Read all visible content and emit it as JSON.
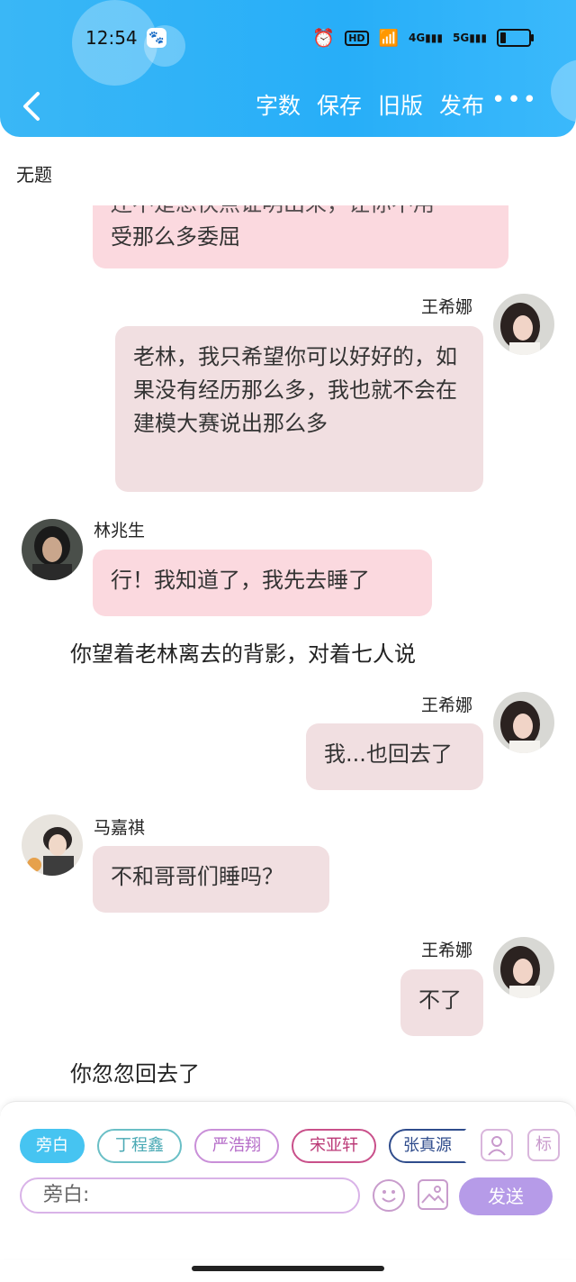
{
  "status": {
    "time": "12:54",
    "app_icon": "baidu-paw-icon",
    "hd_label": "HD",
    "signal_4g": "4G",
    "signal_5g": "5G"
  },
  "header": {
    "back_icon": "chevron-left-icon",
    "actions": [
      "字数",
      "保存",
      "旧版",
      "发布"
    ],
    "more_label": "•••"
  },
  "doc": {
    "title": "无题"
  },
  "messages": [
    {
      "type": "bubble-cut",
      "text": "受那么多委屈",
      "partial_text": "还不是想快点证明出来，让你不用"
    },
    {
      "type": "right",
      "name": "王希娜",
      "text": "老林，我只希望你可以好好的，如果没有经历那么多，我也就不会在建模大赛说出那么多"
    },
    {
      "type": "left",
      "name": "林兆生",
      "text": "行！我知道了，我先去睡了"
    },
    {
      "type": "narration",
      "text": "你望着老林离去的背影，对着七人说"
    },
    {
      "type": "right",
      "name": "王希娜",
      "text": "我...也回去了"
    },
    {
      "type": "left",
      "name": "马嘉祺",
      "text": "不和哥哥们睡吗？"
    },
    {
      "type": "right",
      "name": "王希娜",
      "text": "不了"
    },
    {
      "type": "narration",
      "text": "你忽忽回去了"
    }
  ],
  "panel": {
    "chips": [
      {
        "label": "旁白",
        "color": "#3fc3f0",
        "selected": true
      },
      {
        "label": "丁程鑫",
        "color": "#5fb8c2"
      },
      {
        "label": "严浩翔",
        "color": "#c27fd1"
      },
      {
        "label": "宋亚轩",
        "color": "#c4427b"
      },
      {
        "label": "张真源",
        "color": "#2f4c8c"
      }
    ],
    "mark_label": "标",
    "input_value": "旁白:",
    "send_label": "发送"
  },
  "colors": {
    "header": "#2bb0f7",
    "bubble_pink": "#fbd9df",
    "bubble_self": "#f1dfe1",
    "send": "#b69be8"
  }
}
